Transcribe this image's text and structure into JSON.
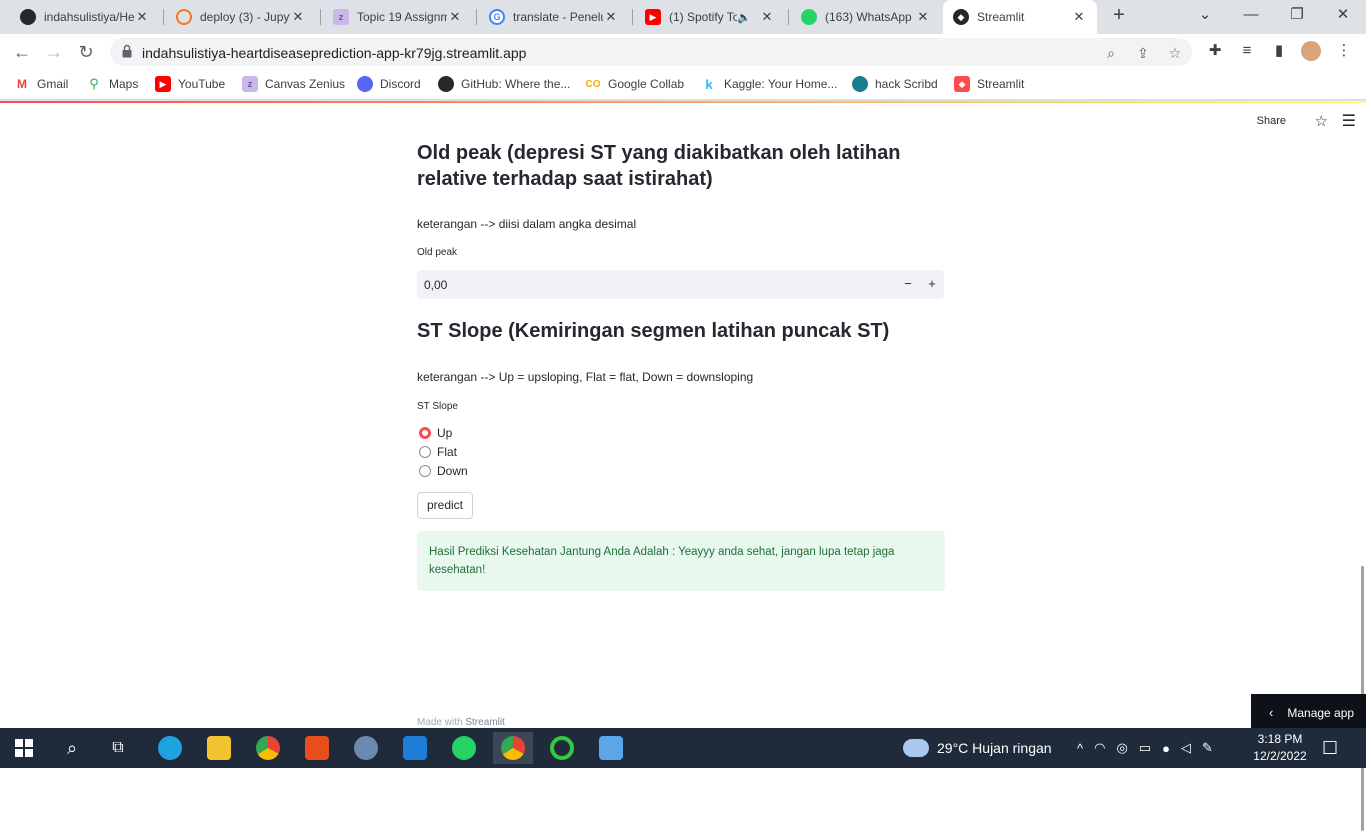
{
  "browser": {
    "tabs": [
      {
        "title": "indahsulistiya/He",
        "favicon": "github-icon"
      },
      {
        "title": "deploy (3) - Jupyt",
        "favicon": "jupyter-icon"
      },
      {
        "title": "Topic 19 Assignm",
        "favicon": "zenius-icon"
      },
      {
        "title": "translate - Penelu",
        "favicon": "google-icon"
      },
      {
        "title": "(1) Spotify To",
        "favicon": "youtube-icon"
      },
      {
        "title": "(163) WhatsApp",
        "favicon": "whatsapp-icon"
      },
      {
        "title": "Streamlit",
        "favicon": "streamlit-icon"
      }
    ],
    "active_tab": 6,
    "url": "indahsulistiya-heartdiseaseprediction-app-kr79jg.streamlit.app",
    "bookmarks": [
      {
        "label": "Gmail",
        "icon": "gmail-icon"
      },
      {
        "label": "Maps",
        "icon": "maps-icon"
      },
      {
        "label": "YouTube",
        "icon": "youtube-icon"
      },
      {
        "label": "Canvas Zenius",
        "icon": "zenius-icon"
      },
      {
        "label": "Discord",
        "icon": "discord-icon"
      },
      {
        "label": "GitHub: Where the...",
        "icon": "github-icon"
      },
      {
        "label": "Google Collab",
        "icon": "colab-icon"
      },
      {
        "label": "Kaggle: Your Home...",
        "icon": "kaggle-icon"
      },
      {
        "label": "hack Scribd",
        "icon": "scribd-icon"
      },
      {
        "label": "Streamlit",
        "icon": "streamlit-icon"
      }
    ]
  },
  "streamlit": {
    "share_label": "Share",
    "oldpeak": {
      "heading": "Old peak (depresi ST yang diakibatkan oleh latihan relative terhadap saat istirahat)",
      "description": "keterangan --> diisi dalam angka desimal",
      "input_label": "Old peak",
      "input_value": "0,00",
      "minus": "−",
      "plus": "+"
    },
    "stslope": {
      "heading": "ST Slope (Kemiringan segmen latihan puncak ST)",
      "description": "keterangan --> Up = upsloping, Flat = flat, Down = downsloping",
      "input_label": "ST Slope",
      "options": [
        "Up",
        "Flat",
        "Down"
      ],
      "selected": "Up"
    },
    "predict_button": "predict",
    "result": "Hasil Prediksi Kesehatan Jantung Anda Adalah : Yeayyy anda sehat, jangan lupa tetap jaga kesehatan!",
    "footer_prefix": "Made with",
    "footer_brand": "Streamlit",
    "manage_app": "Manage app",
    "accent_color": "#ff4b4b"
  },
  "taskbar": {
    "weather": "29°C  Hujan ringan",
    "time": "3:18 PM",
    "date": "12/2/2022"
  }
}
